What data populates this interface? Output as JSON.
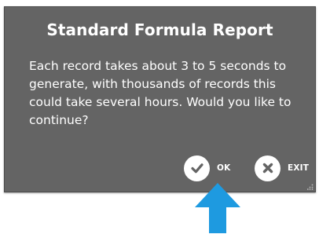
{
  "dialog": {
    "title": "Standard Formula Report",
    "message": "Each record takes about 3 to 5 seconds to generate, with thousands of records this could take several hours. Would you like to continue?",
    "ok_label": "OK",
    "exit_label": "EXIT",
    "ok_icon": "checkmark-icon",
    "exit_icon": "close-icon",
    "background_color": "#646464"
  },
  "annotation": {
    "icon": "arrow-up-icon",
    "color": "#1e9ae0"
  }
}
